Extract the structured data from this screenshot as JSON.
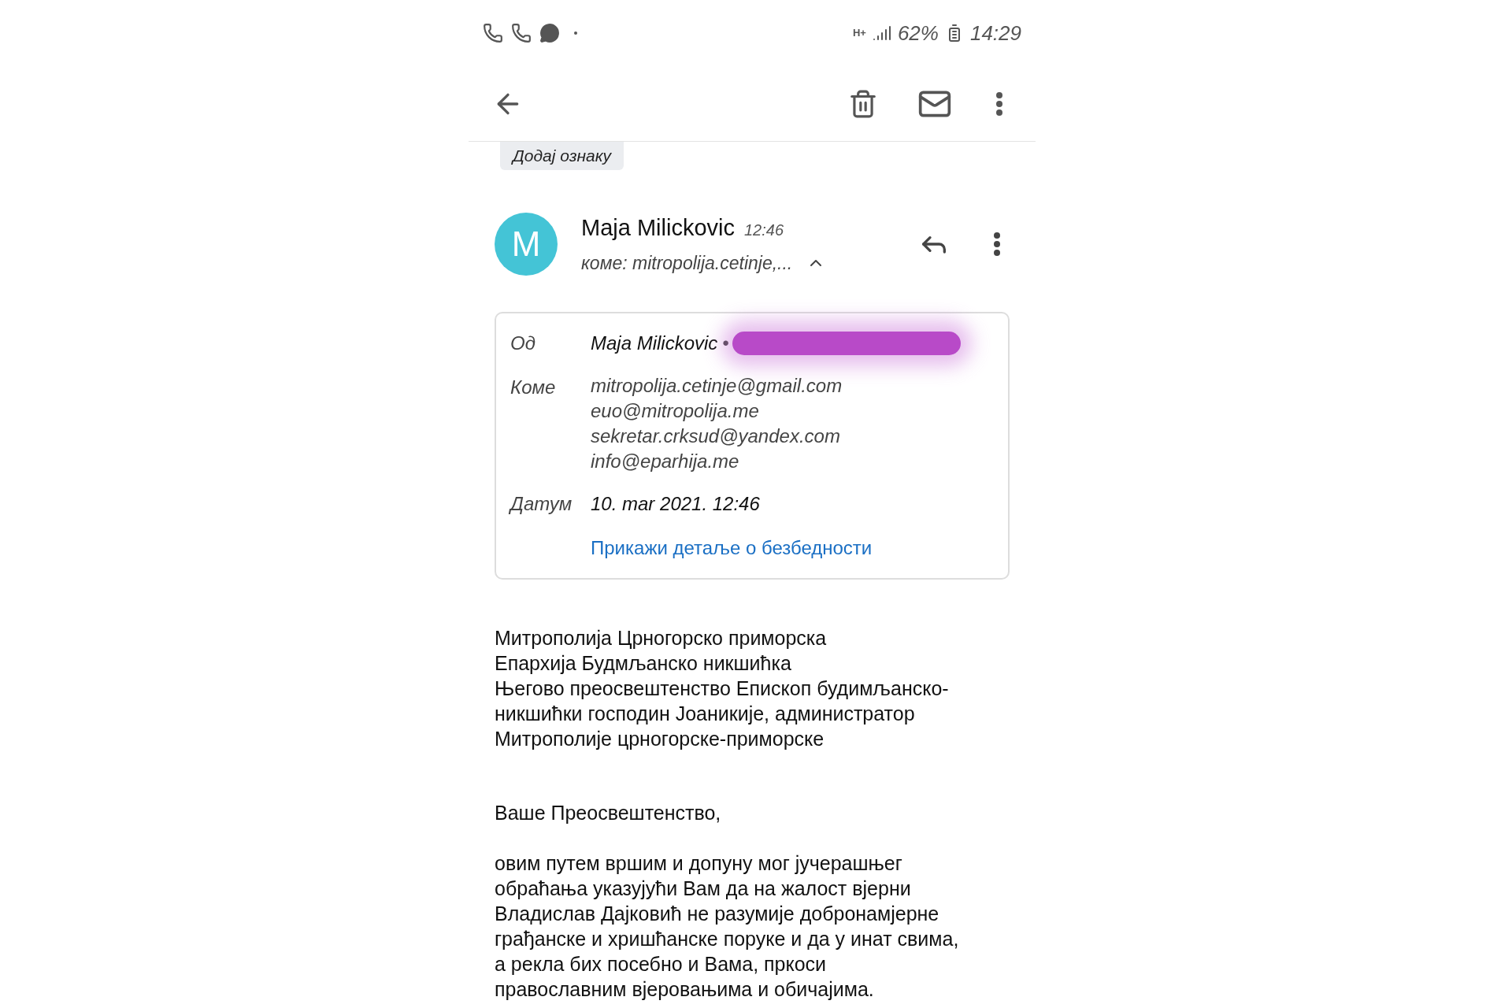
{
  "status_bar": {
    "network": "H+",
    "battery": "62%",
    "time": "14:29"
  },
  "label_chip": "Додај ознаку",
  "message": {
    "avatar_letter": "M",
    "sender": "Maja Milickovic",
    "time": "12:46",
    "to_summary": "коме: mitropolija.cetinje,...",
    "details_expanded": true
  },
  "details": {
    "from_label": "Од",
    "from_name": "Maja Milickovic",
    "from_separator": "•",
    "to_label": "Коме",
    "to": [
      "mitropolija.cetinje@gmail.com",
      "euo@mitropolija.me",
      "sekretar.crksud@yandex.com",
      "info@eparhija.me"
    ],
    "date_label": "Датум",
    "date": "10. mar 2021. 12:46",
    "security_link": "Прикажи детаље о безбедности"
  },
  "body": [
    {
      "lines": [
        "Митрополија Црногорско приморска",
        "Епархија Будмљанско никшићка",
        "Његово преосвештенство Епископ будимљанско-",
        "никшићки господин Јоаникије, администратор",
        "Митрополије црногорске-приморске"
      ]
    },
    {
      "lines": [
        "Ваше Преосвештенство,"
      ]
    },
    {
      "lines": [
        "овим путем вршим и допуну мог јучерашњег",
        "обраћања указујући Вам да на жалост вјерни",
        "Владислав Дајковић не разумије добронамјерне",
        "грађанске и хришћанске поруке и да у инат свима,",
        "а рекла бих посебно и Вама, пркоси",
        "православним вјеровањима и обичајима."
      ]
    }
  ]
}
